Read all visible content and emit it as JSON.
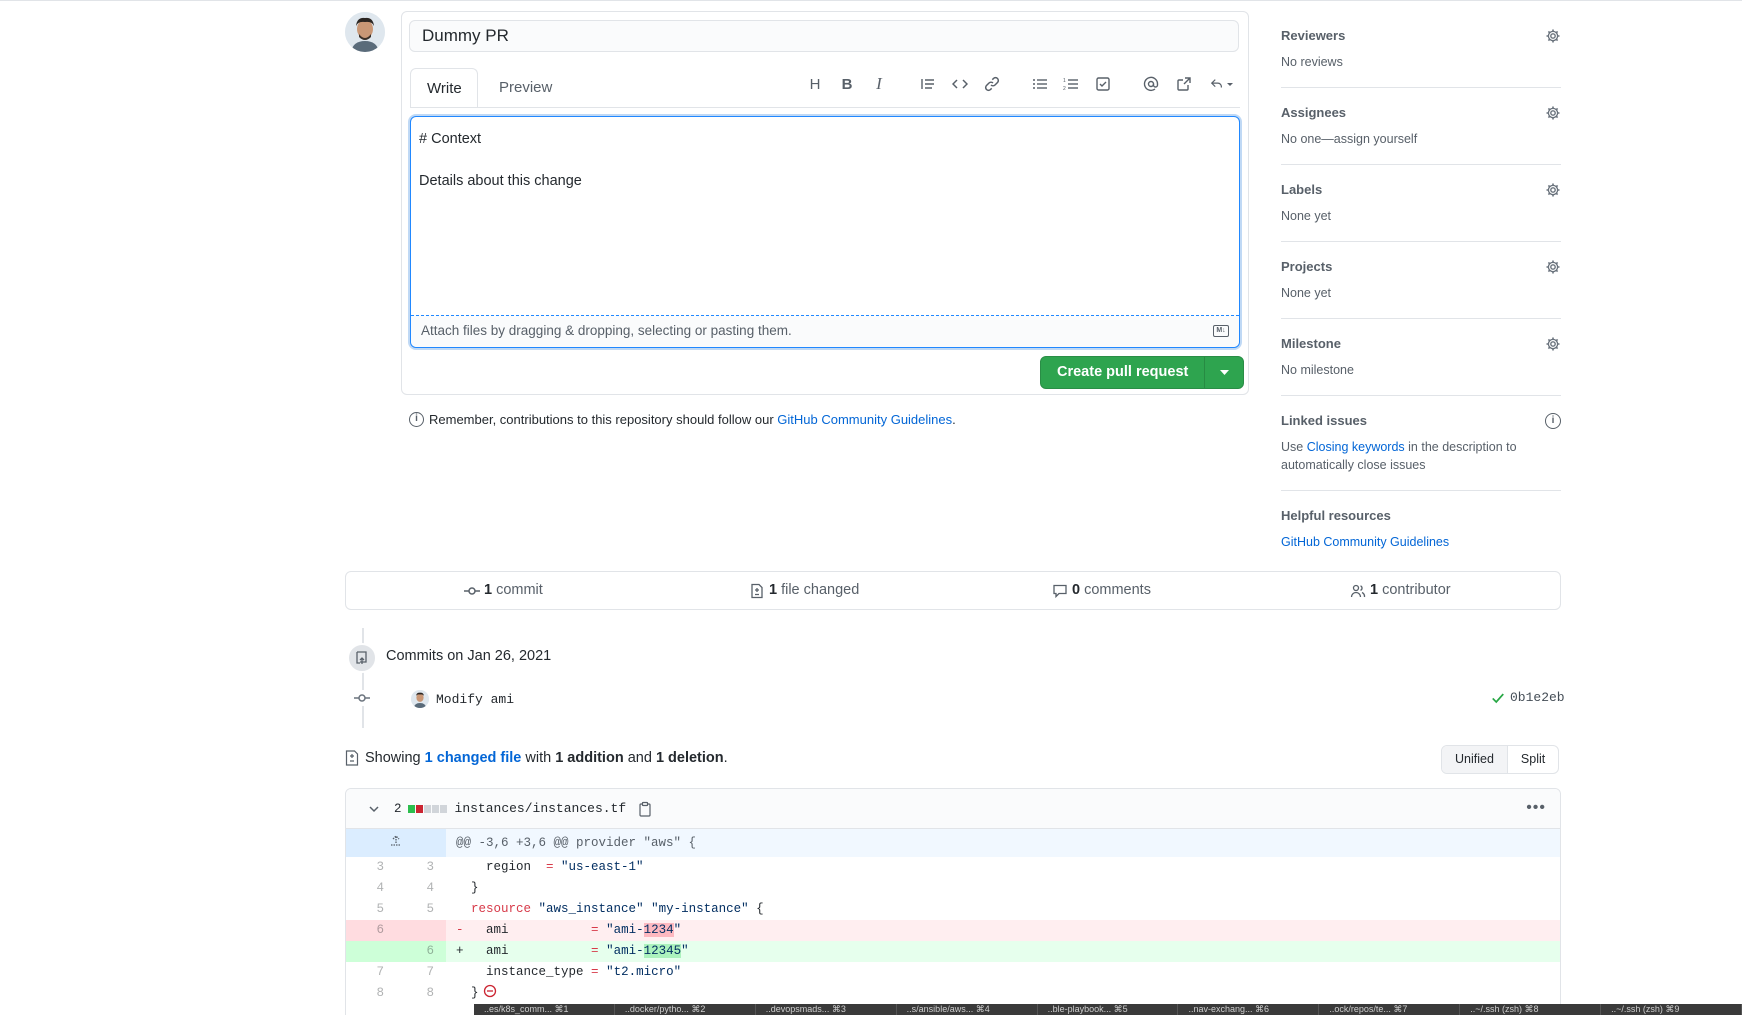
{
  "pr": {
    "title_value": "Dummy PR",
    "tabs": {
      "write": "Write",
      "preview": "Preview"
    },
    "body_lines": [
      "# Context",
      "",
      "Details about this change"
    ],
    "attach_text": "Attach files by dragging & dropping, selecting or pasting them.",
    "markdown_badge": "M↓",
    "create_button": "Create pull request",
    "note_prefix": "Remember, contributions to this repository should follow our ",
    "note_link": "GitHub Community Guidelines",
    "note_suffix": "."
  },
  "sidebar": {
    "reviewers": {
      "title": "Reviewers",
      "value": "No reviews"
    },
    "assignees": {
      "title": "Assignees",
      "value": "No one—assign yourself"
    },
    "labels": {
      "title": "Labels",
      "value": "None yet"
    },
    "projects": {
      "title": "Projects",
      "value": "None yet"
    },
    "milestone": {
      "title": "Milestone",
      "value": "No milestone"
    },
    "linked_issues": {
      "title": "Linked issues",
      "prefix": "Use ",
      "link": "Closing keywords",
      "suffix": " in the description to automatically close issues"
    },
    "helpful": {
      "title": "Helpful resources",
      "link": "GitHub Community Guidelines"
    }
  },
  "summary": {
    "commit_count": "1",
    "commit_label": "commit",
    "files_count": "1",
    "files_label": "file changed",
    "comments_count": "0",
    "comments_label": "comments",
    "contrib_count": "1",
    "contrib_label": "contributor"
  },
  "commits": {
    "date_label": "Commits on Jan 26, 2021",
    "message": "Modify ami",
    "sha": "0b1e2eb"
  },
  "diffstat": {
    "prefix": "Showing ",
    "link": "1 changed file",
    "middle1": " with ",
    "additions": "1 addition",
    "middle2": " and ",
    "deletions": "1 deletion",
    "suffix": "."
  },
  "view_toggle": {
    "unified": "Unified",
    "split": "Split"
  },
  "file": {
    "change_count": "2",
    "name": "instances/instances.tf",
    "hunk": "@@ -3,6 +3,6 @@ provider \"aws\" {",
    "lines": [
      {
        "type": "ctx",
        "old": "3",
        "new": "3",
        "text": "    region  = \"us-east-1\""
      },
      {
        "type": "ctx",
        "old": "4",
        "new": "4",
        "text": "  }"
      },
      {
        "type": "ctx",
        "old": "5",
        "new": "5",
        "text": "  resource \"aws_instance\" \"my-instance\" {"
      },
      {
        "type": "del",
        "old": "6",
        "new": "",
        "text": "-   ami           = \"ami-1234\""
      },
      {
        "type": "add",
        "old": "",
        "new": "6",
        "text": "+   ami           = \"ami-12345\""
      },
      {
        "type": "ctx",
        "old": "7",
        "new": "7",
        "text": "    instance_type = \"t2.micro\""
      },
      {
        "type": "ctx",
        "old": "8",
        "new": "8",
        "text": "  }"
      }
    ]
  },
  "terminal_tabs": [
    "..es/k8s_comm...   ⌘1",
    "..docker/pytho...   ⌘2",
    "..devopsmads...   ⌘3",
    "..s/ansible/aws...   ⌘4",
    "..ble-playbook...   ⌘5",
    "..nav-exchang...   ⌘6",
    "..ock/repos/te...   ⌘7",
    "..~/.ssh (zsh)   ⌘8",
    "..~/.ssh (zsh)   ⌘9"
  ],
  "colors": {
    "green": "#2ea44f",
    "link": "#0366d6",
    "focus": "#2188ff"
  }
}
